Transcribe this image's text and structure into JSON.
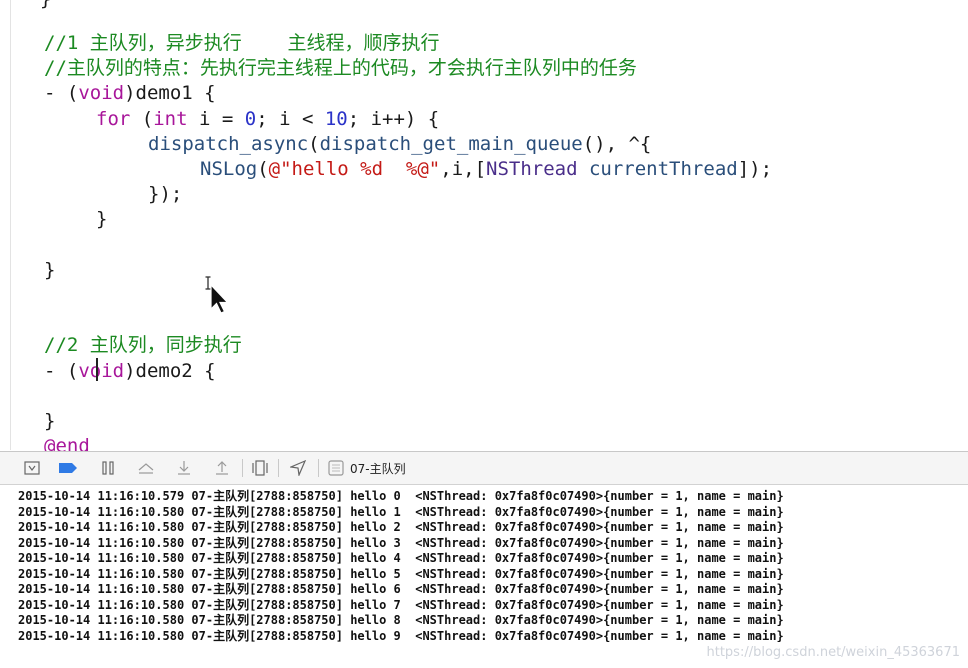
{
  "editor": {
    "lines": [
      {
        "parts": [
          {
            "t": "//1 主队列，异步执行    主线程，顺序执行",
            "c": "comment"
          }
        ]
      },
      {
        "parts": [
          {
            "t": "//主队列的特点：先执行完主线程上的代码，才会执行主队列中的任务",
            "c": "comment"
          }
        ]
      },
      {
        "parts": [
          {
            "t": "- (",
            "c": "plain"
          },
          {
            "t": "void",
            "c": "kw"
          },
          {
            "t": ")demo1 {",
            "c": "plain"
          }
        ]
      },
      {
        "indent": 4,
        "parts": [
          {
            "t": "for",
            "c": "kw"
          },
          {
            "t": " (",
            "c": "plain"
          },
          {
            "t": "int",
            "c": "kw"
          },
          {
            "t": " i = ",
            "c": "plain"
          },
          {
            "t": "0",
            "c": "num"
          },
          {
            "t": "; i < ",
            "c": "plain"
          },
          {
            "t": "10",
            "c": "num"
          },
          {
            "t": "; i++) {",
            "c": "plain"
          }
        ]
      },
      {
        "indent": 8,
        "parts": [
          {
            "t": "dispatch_async",
            "c": "fn"
          },
          {
            "t": "(",
            "c": "plain"
          },
          {
            "t": "dispatch_get_main_queue",
            "c": "fn"
          },
          {
            "t": "(), ^{",
            "c": "plain"
          }
        ]
      },
      {
        "indent": 12,
        "parts": [
          {
            "t": "NSLog",
            "c": "fn"
          },
          {
            "t": "(",
            "c": "plain"
          },
          {
            "t": "@\"hello %d  %@\"",
            "c": "str"
          },
          {
            "t": ",i,[",
            "c": "plain"
          },
          {
            "t": "NSThread",
            "c": "cls"
          },
          {
            "t": " ",
            "c": "plain"
          },
          {
            "t": "currentThread",
            "c": "fn"
          },
          {
            "t": "]);",
            "c": "plain"
          }
        ]
      },
      {
        "indent": 8,
        "parts": [
          {
            "t": "});",
            "c": "plain"
          }
        ]
      },
      {
        "indent": 4,
        "parts": [
          {
            "t": "}",
            "c": "plain"
          }
        ]
      },
      {
        "parts": []
      },
      {
        "parts": [
          {
            "t": "}",
            "c": "plain"
          }
        ]
      },
      {
        "parts": []
      },
      {
        "parts": []
      },
      {
        "parts": [
          {
            "t": "//2 主队列，同步执行",
            "c": "comment"
          }
        ]
      },
      {
        "parts": [
          {
            "t": "- (",
            "c": "plain"
          },
          {
            "t": "void",
            "c": "kw"
          },
          {
            "t": ")demo2 {",
            "c": "plain"
          }
        ]
      },
      {
        "parts": []
      },
      {
        "parts": [
          {
            "t": "}",
            "c": "plain"
          }
        ]
      },
      {
        "parts": [
          {
            "t": "@end",
            "c": "kw"
          }
        ]
      }
    ],
    "top_fragment": "}"
  },
  "debug_bar": {
    "thread_label": "07-主队列",
    "buttons": [
      {
        "name": "hide-debug-area-button",
        "icon": "panel-toggle-icon"
      },
      {
        "name": "breakpoints-toggle-button",
        "icon": "breakpoint-icon"
      },
      {
        "name": "pause-continue-button",
        "icon": "pause-icon"
      },
      {
        "name": "step-over-button",
        "icon": "step-over-icon"
      },
      {
        "name": "step-into-button",
        "icon": "step-into-icon"
      },
      {
        "name": "step-out-button",
        "icon": "step-out-icon"
      },
      {
        "name": "view-debugger-button",
        "icon": "view-hierarchy-icon"
      },
      {
        "name": "simulate-location-button",
        "icon": "location-arrow-icon"
      }
    ]
  },
  "console": {
    "lines": [
      "2015-10-14 11:16:10.579 07-主队列[2788:858750] hello 0  <NSThread: 0x7fa8f0c07490>{number = 1, name = main}",
      "2015-10-14 11:16:10.580 07-主队列[2788:858750] hello 1  <NSThread: 0x7fa8f0c07490>{number = 1, name = main}",
      "2015-10-14 11:16:10.580 07-主队列[2788:858750] hello 2  <NSThread: 0x7fa8f0c07490>{number = 1, name = main}",
      "2015-10-14 11:16:10.580 07-主队列[2788:858750] hello 3  <NSThread: 0x7fa8f0c07490>{number = 1, name = main}",
      "2015-10-14 11:16:10.580 07-主队列[2788:858750] hello 4  <NSThread: 0x7fa8f0c07490>{number = 1, name = main}",
      "2015-10-14 11:16:10.580 07-主队列[2788:858750] hello 5  <NSThread: 0x7fa8f0c07490>{number = 1, name = main}",
      "2015-10-14 11:16:10.580 07-主队列[2788:858750] hello 6  <NSThread: 0x7fa8f0c07490>{number = 1, name = main}",
      "2015-10-14 11:16:10.580 07-主队列[2788:858750] hello 7  <NSThread: 0x7fa8f0c07490>{number = 1, name = main}",
      "2015-10-14 11:16:10.580 07-主队列[2788:858750] hello 8  <NSThread: 0x7fa8f0c07490>{number = 1, name = main}",
      "2015-10-14 11:16:10.580 07-主队列[2788:858750] hello 9  <NSThread: 0x7fa8f0c07490>{number = 1, name = main}"
    ]
  },
  "watermark": "https://blog.csdn.net/weixin_45363671"
}
